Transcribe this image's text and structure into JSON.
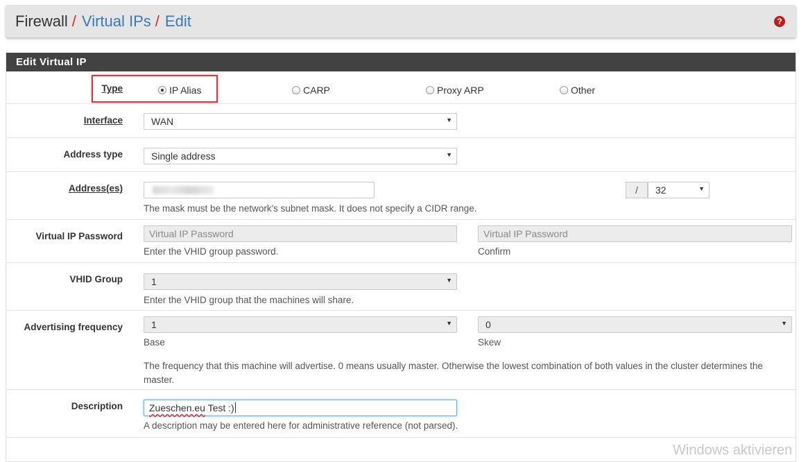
{
  "breadcrumb": {
    "root": "Firewall",
    "separator": "/",
    "items": [
      "Virtual IPs",
      "Edit"
    ],
    "help_icon": "question-circle-icon"
  },
  "panel": {
    "title": "Edit Virtual IP"
  },
  "type": {
    "label": "Type",
    "options": [
      "IP Alias",
      "CARP",
      "Proxy ARP",
      "Other"
    ],
    "selected": "IP Alias"
  },
  "interface": {
    "label": "Interface",
    "value": "WAN"
  },
  "address_type": {
    "label": "Address type",
    "value": "Single address"
  },
  "address": {
    "label": "Address(es)",
    "value": "",
    "mask_separator": "/",
    "mask": "32",
    "help": "The mask must be the network's subnet mask. It does not specify a CIDR range."
  },
  "vip_password": {
    "label": "Virtual IP Password",
    "placeholder": "Virtual IP Password",
    "help": "Enter the VHID group password.",
    "confirm_placeholder": "Virtual IP Password",
    "confirm_help": "Confirm"
  },
  "vhid_group": {
    "label": "VHID Group",
    "value": "1",
    "help": "Enter the VHID group that the machines will share."
  },
  "advertising": {
    "label": "Advertising frequency",
    "base_value": "1",
    "base_help": "Base",
    "skew_value": "0",
    "skew_help": "Skew",
    "help": "The frequency that this machine will advertise. 0 means usually master. Otherwise the lowest combination of both values in the cluster determines the master."
  },
  "description": {
    "label": "Description",
    "value_word": "Zueschen.eu",
    "value_rest": " Test :)",
    "help": "A description may be entered here for administrative reference (not parsed)."
  },
  "watermark": "Windows aktivieren",
  "colors": {
    "header_bar": "#424242",
    "link": "#3a7ab2",
    "separator": "#c9302c",
    "highlight": "#e0333a",
    "help_icon": "#c01c1c"
  }
}
